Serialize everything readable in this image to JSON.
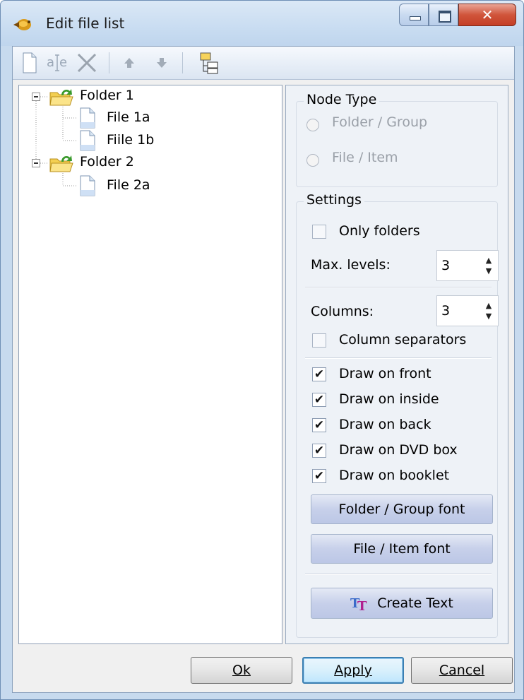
{
  "window": {
    "title": "Edit file list"
  },
  "tree": {
    "nodes": [
      {
        "label": "Folder 1",
        "type": "folder"
      },
      {
        "label": "File 1a",
        "type": "file"
      },
      {
        "label": "Fiile 1b",
        "type": "file"
      },
      {
        "label": "Folder 2",
        "type": "folder"
      },
      {
        "label": "File 2a",
        "type": "file"
      }
    ]
  },
  "node_type": {
    "title": "Node Type",
    "folder_group": "Folder / Group",
    "file_item": "File / Item"
  },
  "settings": {
    "title": "Settings",
    "only_folders": "Only folders",
    "max_levels_label": "Max. levels:",
    "max_levels_value": "3",
    "columns_label": "Columns:",
    "columns_value": "3",
    "column_separators": "Column separators",
    "draw_on_front": "Draw on front",
    "draw_on_inside": "Draw on inside",
    "draw_on_back": "Draw on back",
    "draw_on_dvd_box": "Draw on DVD box",
    "draw_on_booklet": "Draw on booklet",
    "folder_group_font": "Folder / Group font",
    "file_item_font": "File / Item font",
    "create_text": "Create Text"
  },
  "footer": {
    "ok": "Ok",
    "apply": "Apply",
    "cancel": "Cancel"
  },
  "colors": {
    "title_bar": "#c8dcf1",
    "close_button": "#d0553b",
    "default_button_border": "#3c7fb1",
    "panel_button": "#c7d0ea"
  },
  "icons": [
    "app-icon",
    "new-file-icon",
    "rename-icon",
    "delete-icon",
    "move-up-icon",
    "move-down-icon",
    "tree-view-icon",
    "folder-icon",
    "file-icon",
    "create-text-icon"
  ]
}
